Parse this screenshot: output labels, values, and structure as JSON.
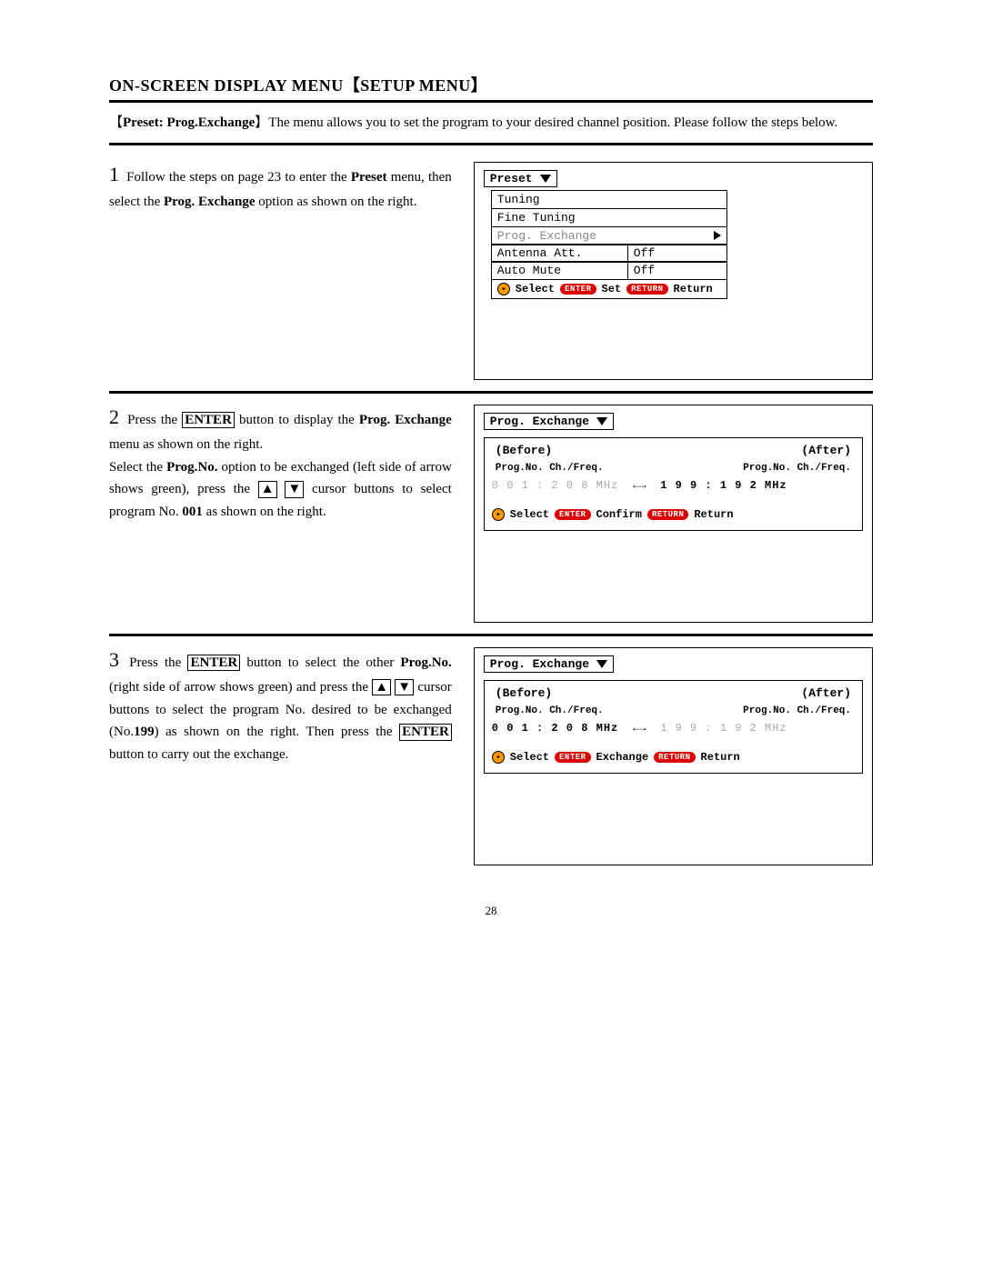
{
  "page_title_a": "ON-SCREEN DISPLAY MENU",
  "page_title_b": "SETUP MENU",
  "intro_heading": "Preset: Prog.Exchange",
  "intro_body": "The menu allows you to set the program to your desired channel position. Please follow the steps below.",
  "step1": {
    "num": "1",
    "text_a": "Follow the steps on page 23 to enter the ",
    "preset": "Preset",
    "text_b": " menu, then select the ",
    "prog_ex": "Prog. Exchange",
    "text_c": " option as shown on the right."
  },
  "fig1": {
    "header": "Preset",
    "items": {
      "tuning": "Tuning",
      "fine": "Fine Tuning",
      "prog_ex": "Prog. Exchange",
      "antenna": "Antenna Att.",
      "auto_mute": "Auto Mute",
      "off1": "Off",
      "off2": "Off"
    },
    "hints": {
      "select": "Select",
      "set": "Set",
      "ret": "Return",
      "enter": "ENTER",
      "return": "RETURN"
    }
  },
  "step2": {
    "num": "2",
    "t1": "Press the ",
    "enter": "ENTER",
    "t2": " button to display the ",
    "prog_ex": "Prog. Exchange",
    "t3": " menu as shown on the right.",
    "t4": "Select the ",
    "progno": "Prog.No.",
    "t5": " option to be exchanged (left side of arrow shows green), press the ",
    "t6": " cursor buttons to select program No. ",
    "no001": "001",
    "t7": " as shown on the right."
  },
  "fig2": {
    "header": "Prog. Exchange",
    "before": "(Before)",
    "after": "(After)",
    "col_l": "Prog.No. Ch./Freq.",
    "col_r": "Prog.No. Ch./Freq.",
    "left_val": "0 0 1 : 2 0 8 MHz",
    "right_val": "1 9 9 : 1 9 2 MHz",
    "left_grey": true,
    "right_grey": false,
    "hints": {
      "select": "Select",
      "mid": "Confirm",
      "ret": "Return",
      "enter": "ENTER",
      "return": "RETURN"
    }
  },
  "step3": {
    "num": "3",
    "t1": "Press the ",
    "enter": "ENTER",
    "t2": " button to select the other ",
    "progno": "Prog.No.",
    "t3": " (right side of arrow shows green) and press the ",
    "t4": " cursor buttons to select the program No. desired to be exchanged (No.",
    "no199": "199",
    "t5": ") as shown on the right. Then press the ",
    "t6": " button to carry out the exchange."
  },
  "fig3": {
    "header": "Prog. Exchange",
    "before": "(Before)",
    "after": "(After)",
    "col_l": "Prog.No. Ch./Freq.",
    "col_r": "Prog.No. Ch./Freq.",
    "left_val": "0 0 1 : 2 0 8 MHz",
    "right_val": "1 9 9 : 1 9 2 MHz",
    "left_grey": false,
    "right_grey": true,
    "hints": {
      "select": "Select",
      "mid": "Exchange",
      "ret": "Return",
      "enter": "ENTER",
      "return": "RETURN"
    }
  },
  "pagenum": "28",
  "glyph": {
    "up": "▲",
    "down": "▼",
    "lr": "←→"
  }
}
